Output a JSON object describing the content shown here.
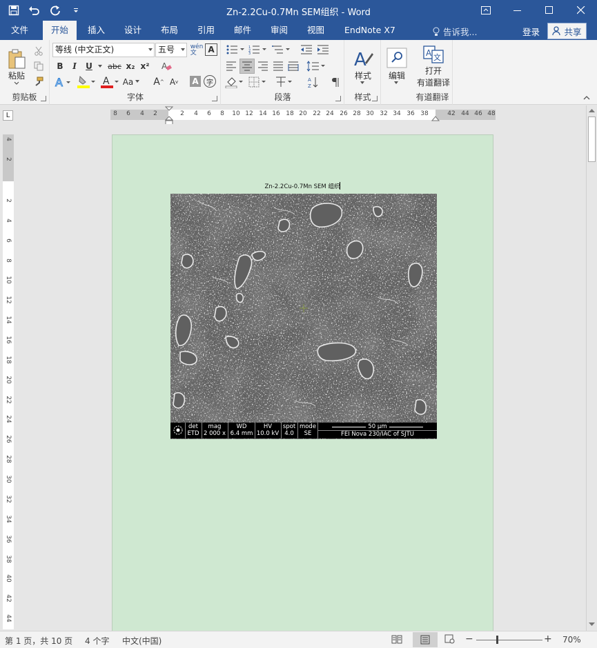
{
  "window": {
    "title": "Zn-2.2Cu-0.7Mn SEM组织 - Word"
  },
  "tabs": [
    "文件",
    "开始",
    "插入",
    "设计",
    "布局",
    "引用",
    "邮件",
    "审阅",
    "视图",
    "EndNote X7"
  ],
  "active_tab": "开始",
  "tell_me": "告诉我...",
  "login": "登录",
  "share": "共享",
  "ribbon": {
    "clipboard": {
      "label": "剪贴板",
      "paste": "粘贴"
    },
    "font": {
      "label": "字体",
      "font_name": "等线 (中文正文)",
      "font_size": "五号",
      "bold": "B",
      "italic": "I",
      "underline": "U",
      "strike": "abc",
      "subscript": "x₂",
      "superscript": "x²",
      "grow": "A",
      "shrink": "A",
      "case": "Aa"
    },
    "paragraph": {
      "label": "段落"
    },
    "styles": {
      "label": "样式",
      "button": "样式"
    },
    "editing": {
      "button": "编辑"
    },
    "youdao": {
      "label": "有道翻译",
      "button_line1": "打开",
      "button_line2": "有道翻译"
    }
  },
  "hruler_numbers": [
    "8",
    "6",
    "4",
    "2",
    "2",
    "4",
    "6",
    "8",
    "10",
    "12",
    "14",
    "16",
    "18",
    "20",
    "22",
    "24",
    "26",
    "28",
    "30",
    "32",
    "34",
    "36",
    "38",
    "42",
    "44",
    "46",
    "48"
  ],
  "vruler_numbers": [
    "4",
    "2",
    "2",
    "4",
    "6",
    "8",
    "10",
    "12",
    "14",
    "16",
    "18",
    "20",
    "22",
    "24",
    "26",
    "28",
    "30",
    "32",
    "34",
    "36",
    "38",
    "40",
    "42",
    "44"
  ],
  "document": {
    "caption": "Zn-2.2Cu-0.7Mn SEM 组织",
    "sem_footer": {
      "headers": [
        "det",
        "mag",
        "WD",
        "HV",
        "spot",
        "mode"
      ],
      "values": [
        "ETD",
        "2 000 x",
        "6.4 mm",
        "10.0 kV",
        "4.0",
        "SE"
      ],
      "scale": "50 μm",
      "lab": "FEI Nova 230/IAC of SJTU"
    }
  },
  "status": {
    "page": "第 1 页，共 10 页",
    "words": "4 个字",
    "lang": "中文(中国)",
    "zoom": "70%"
  },
  "colors": {
    "brand": "#2b579a",
    "page_bg": "#cfe8d1"
  }
}
